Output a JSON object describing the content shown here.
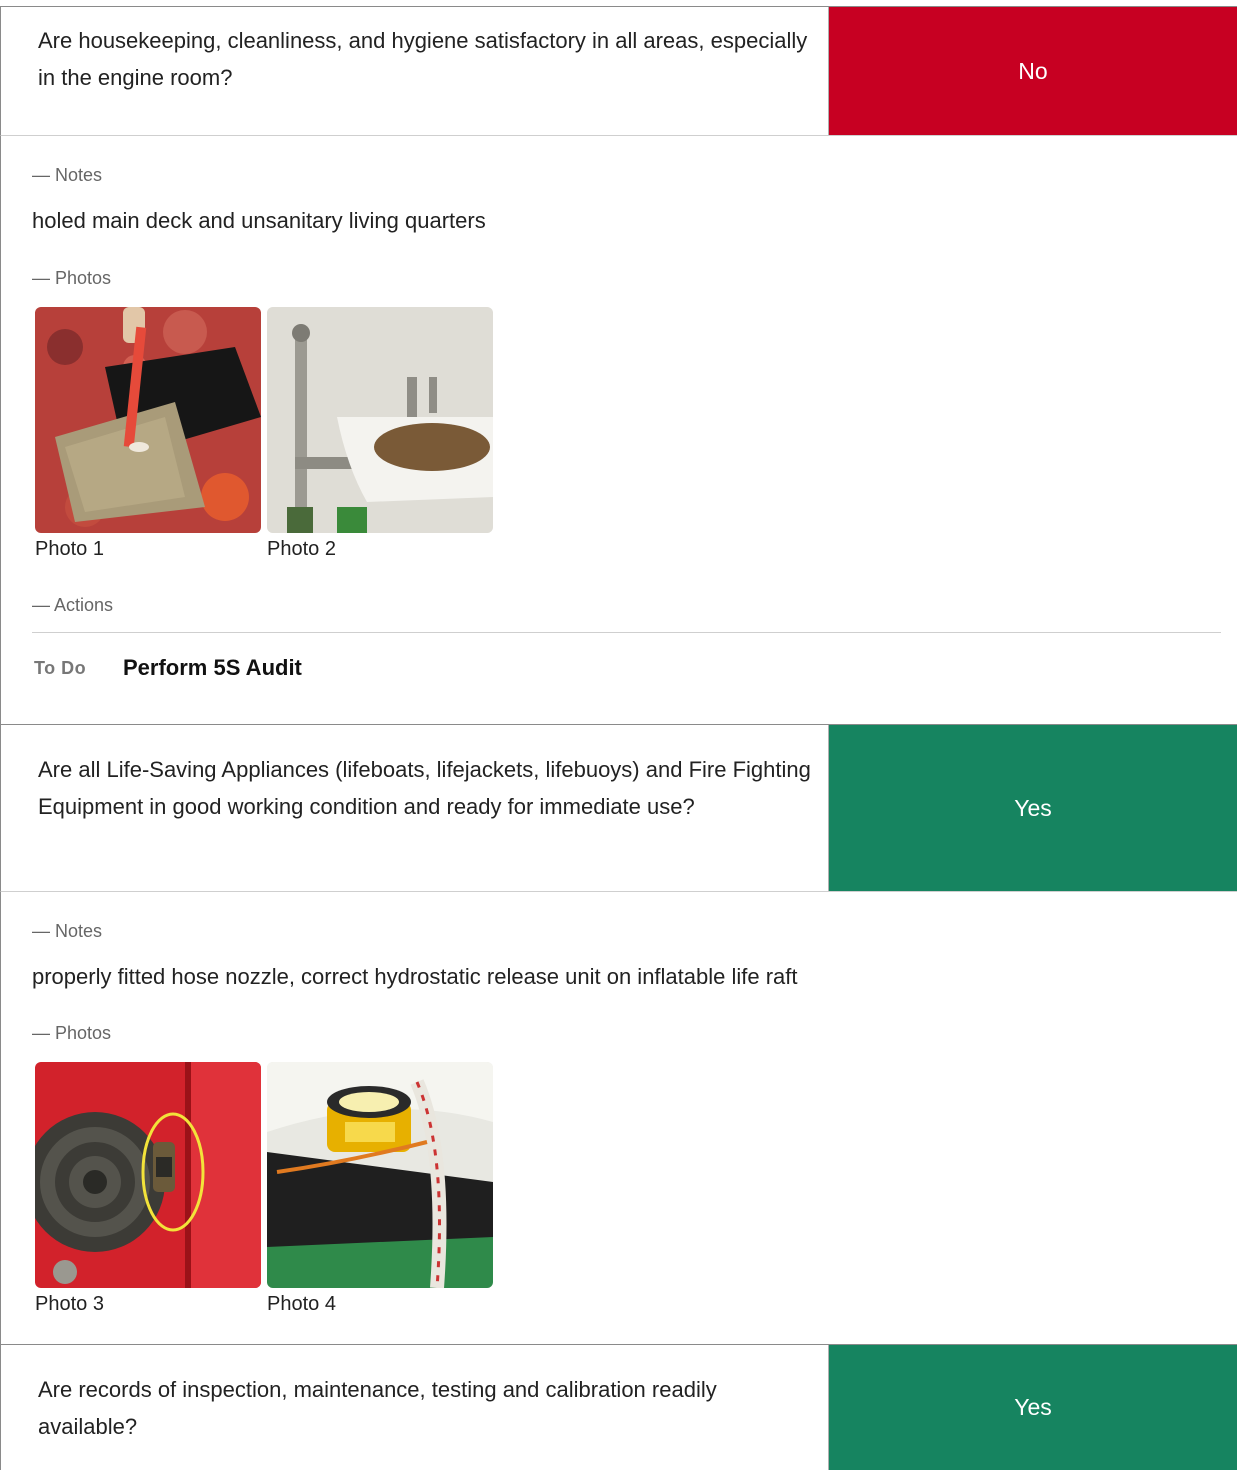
{
  "colors": {
    "no": "#c70022",
    "yes": "#168460"
  },
  "items": [
    {
      "question": "Are housekeeping, cleanliness, and hygiene satisfactory in all areas, especially in the engine room?",
      "answer": "No",
      "notes_label": "— Notes",
      "note": "holed main deck and unsanitary living quarters",
      "photos_label": "— Photos",
      "photos": [
        {
          "caption": "Photo 1",
          "depicts": "pen-through-holed-deck"
        },
        {
          "caption": "Photo 2",
          "depicts": "dirty-sink"
        }
      ],
      "actions_label": "— Actions",
      "action": {
        "status": "To Do",
        "title": "Perform 5S Audit"
      }
    },
    {
      "question": "Are all Life-Saving Appliances (lifeboats, lifejackets, lifebuoys) and Fire Fighting Equipment in good working condition and ready for immediate use?",
      "answer": "Yes",
      "notes_label": "— Notes",
      "note": "properly fitted hose nozzle, correct hydrostatic release unit on inflatable life raft",
      "photos_label": "— Photos",
      "photos": [
        {
          "caption": "Photo 3",
          "depicts": "fire-hose-reel-cabinet"
        },
        {
          "caption": "Photo 4",
          "depicts": "hydrostatic-release-unit"
        }
      ]
    },
    {
      "question": "Are records of inspection, maintenance, testing and calibration readily available?",
      "answer": "Yes"
    }
  ]
}
